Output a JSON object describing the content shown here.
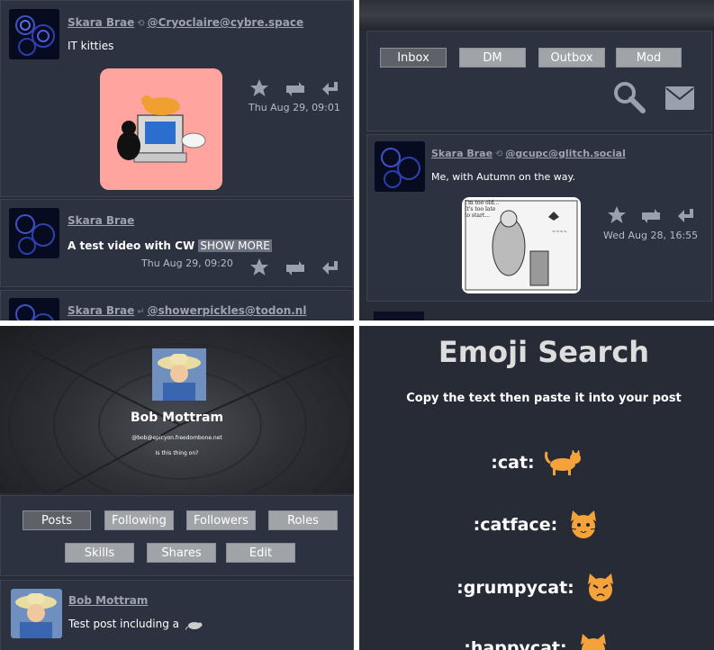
{
  "timeline": {
    "post1": {
      "author": "Skara Brae",
      "boost_handle": "@Cryoclaire@cybre.space",
      "text": "IT kitties",
      "time": "Thu Aug 29, 09:01"
    },
    "post2": {
      "author": "Skara Brae",
      "text": "A test video with CW",
      "cw_button": "SHOW MORE",
      "time": "Thu Aug 29, 09:20"
    },
    "post3": {
      "author": "Skara Brae",
      "reply_handle": "@showerpickles@todon.nl"
    }
  },
  "inbox": {
    "tabs": [
      "Inbox",
      "DM",
      "Outbox",
      "Mod"
    ],
    "post": {
      "author": "Skara Brae",
      "boost_handle": "@gcupc@glitch.social",
      "text": "Me, with Autumn on the way.",
      "time": "Wed Aug 28, 16:55",
      "cartoon_caption": "I'm too old... It's too late to start..."
    }
  },
  "profile": {
    "name": "Bob Mottram",
    "handle": "@bob@epicyon.freedombone.net",
    "bio": "Is this thing on?",
    "tabs_row1": [
      "Posts",
      "Following",
      "Followers",
      "Roles"
    ],
    "tabs_row2": [
      "Skills",
      "Shares",
      "Edit"
    ],
    "post": {
      "author": "Bob Mottram",
      "text": "Test post including a"
    }
  },
  "emoji": {
    "title": "Emoji Search",
    "subtitle": "Copy the text then paste it into your post",
    "items": [
      ":cat:",
      ":catface:",
      ":grumpycat:",
      ":happycat:"
    ]
  },
  "colors": {
    "background": "#282c37",
    "card": "#2d3240",
    "button": "#a0a3a8",
    "button_active": "#5e6167",
    "text": "#ffffff",
    "muted": "#9ea3ad"
  }
}
